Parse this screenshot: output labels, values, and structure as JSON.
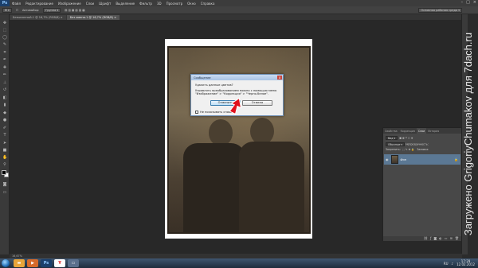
{
  "menubar": {
    "logo": "Ps",
    "items": [
      "Файл",
      "Редактирование",
      "Изображение",
      "Слои",
      "Шрифт",
      "Выделение",
      "Фильтр",
      "3D",
      "Просмотр",
      "Окно",
      "Справка"
    ]
  },
  "options_bar": {
    "mode_label": "Автовыбор:",
    "mode_value": "Группа",
    "workspace": "Основная рабочая среда"
  },
  "tabs": [
    {
      "label": "Безымянный-1 @ 16,7% (RGB/8)",
      "active": false
    },
    {
      "label": "Без имени-1 @ 16,7% (RGB/8)",
      "active": true
    }
  ],
  "dialog": {
    "title": "Сообщение",
    "close": "x",
    "question": "Удалить данные цветов?",
    "message": "Управлять преобразованием можно с помощью меню \"Изображение\" > \"Коррекция\" > \"Черно-белое\".",
    "ok_label": "Отменить",
    "cancel_label": "Отмена",
    "checkbox_label": "Не показывать снова"
  },
  "layers_panel": {
    "tabs": [
      {
        "label": "Свойства",
        "active": false
      },
      {
        "label": "Коррекция",
        "active": false
      },
      {
        "label": "Слои",
        "active": true
      },
      {
        "label": "История",
        "active": false
      }
    ],
    "kind_label": "Вид",
    "blend_mode": "Обычные",
    "opacity_label": "Непрозрачность:",
    "lock_label": "Закрепить:",
    "fill_label": "Заливка:",
    "layer_name": "Фон"
  },
  "statusbar": {
    "zoom": "16,67%"
  },
  "taskbar": {
    "time": "17:29",
    "date": "12.02.2012",
    "lang": "RU"
  },
  "watermark": "Загружено GrigoriyChumakov для 7dach.ru",
  "colors": {
    "accent_arrow": "#e0101c",
    "foreground_color": "#000000",
    "background_color": "#ffffff"
  }
}
